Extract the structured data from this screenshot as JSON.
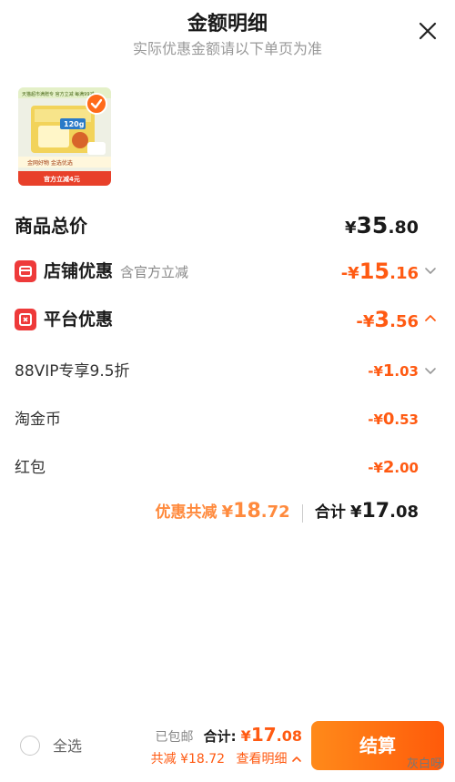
{
  "header": {
    "title": "金额明细",
    "subtitle": "实际优惠金额请以下单页为准"
  },
  "product": {
    "banner_top": "天猫超市满赠专 官方立减 每满99减",
    "pack_label": "120g",
    "banner_mid": "金网好物 金选优选",
    "banner_bottom": "官方立减4元"
  },
  "total": {
    "label": "商品总价",
    "yen": "¥",
    "int": "35",
    "dec": ".80"
  },
  "shop_discount": {
    "label": "店铺优惠",
    "note": "含官方立减",
    "prefix": "-¥",
    "int": "15",
    "dec": ".16"
  },
  "platform_discount": {
    "label": "平台优惠",
    "prefix": "-¥",
    "int": "3",
    "dec": ".56"
  },
  "sub_items": [
    {
      "label": "88VIP专享9.5折",
      "prefix": "-¥",
      "int": "1",
      "dec": ".03"
    },
    {
      "label": "淘金币",
      "prefix": "-¥",
      "int": "0",
      "dec": ".53"
    },
    {
      "label": "红包",
      "prefix": "-¥",
      "int": "2",
      "dec": ".00"
    }
  ],
  "summary": {
    "save_label": "优惠共减",
    "save_yen": "¥",
    "save_int": "18",
    "save_dec": ".72",
    "sum_label": "合计",
    "sum_yen": "¥",
    "sum_int": "17",
    "sum_dec": ".08"
  },
  "bottom": {
    "select_all": "全选",
    "shipping": "已包邮",
    "total_label": "合计:",
    "total_yen": "¥",
    "total_int": "17",
    "total_dec": ".08",
    "saved_text": "共减 ¥18.72",
    "detail_link": "查看明细",
    "checkout": "结算",
    "watermark": "灰白呀"
  },
  "colors": {
    "accent": "#ff5a12",
    "accent_light": "#ff8a3d",
    "discount_icon": "#ee3a3a",
    "text": "#1a1a1a",
    "muted": "#999999"
  },
  "icons": {
    "close": "close-icon",
    "check": "check-icon",
    "shop": "shop-icon",
    "platform": "coupon-icon",
    "chevron_down": "chevron-down-icon",
    "chevron_up": "chevron-up-icon"
  }
}
